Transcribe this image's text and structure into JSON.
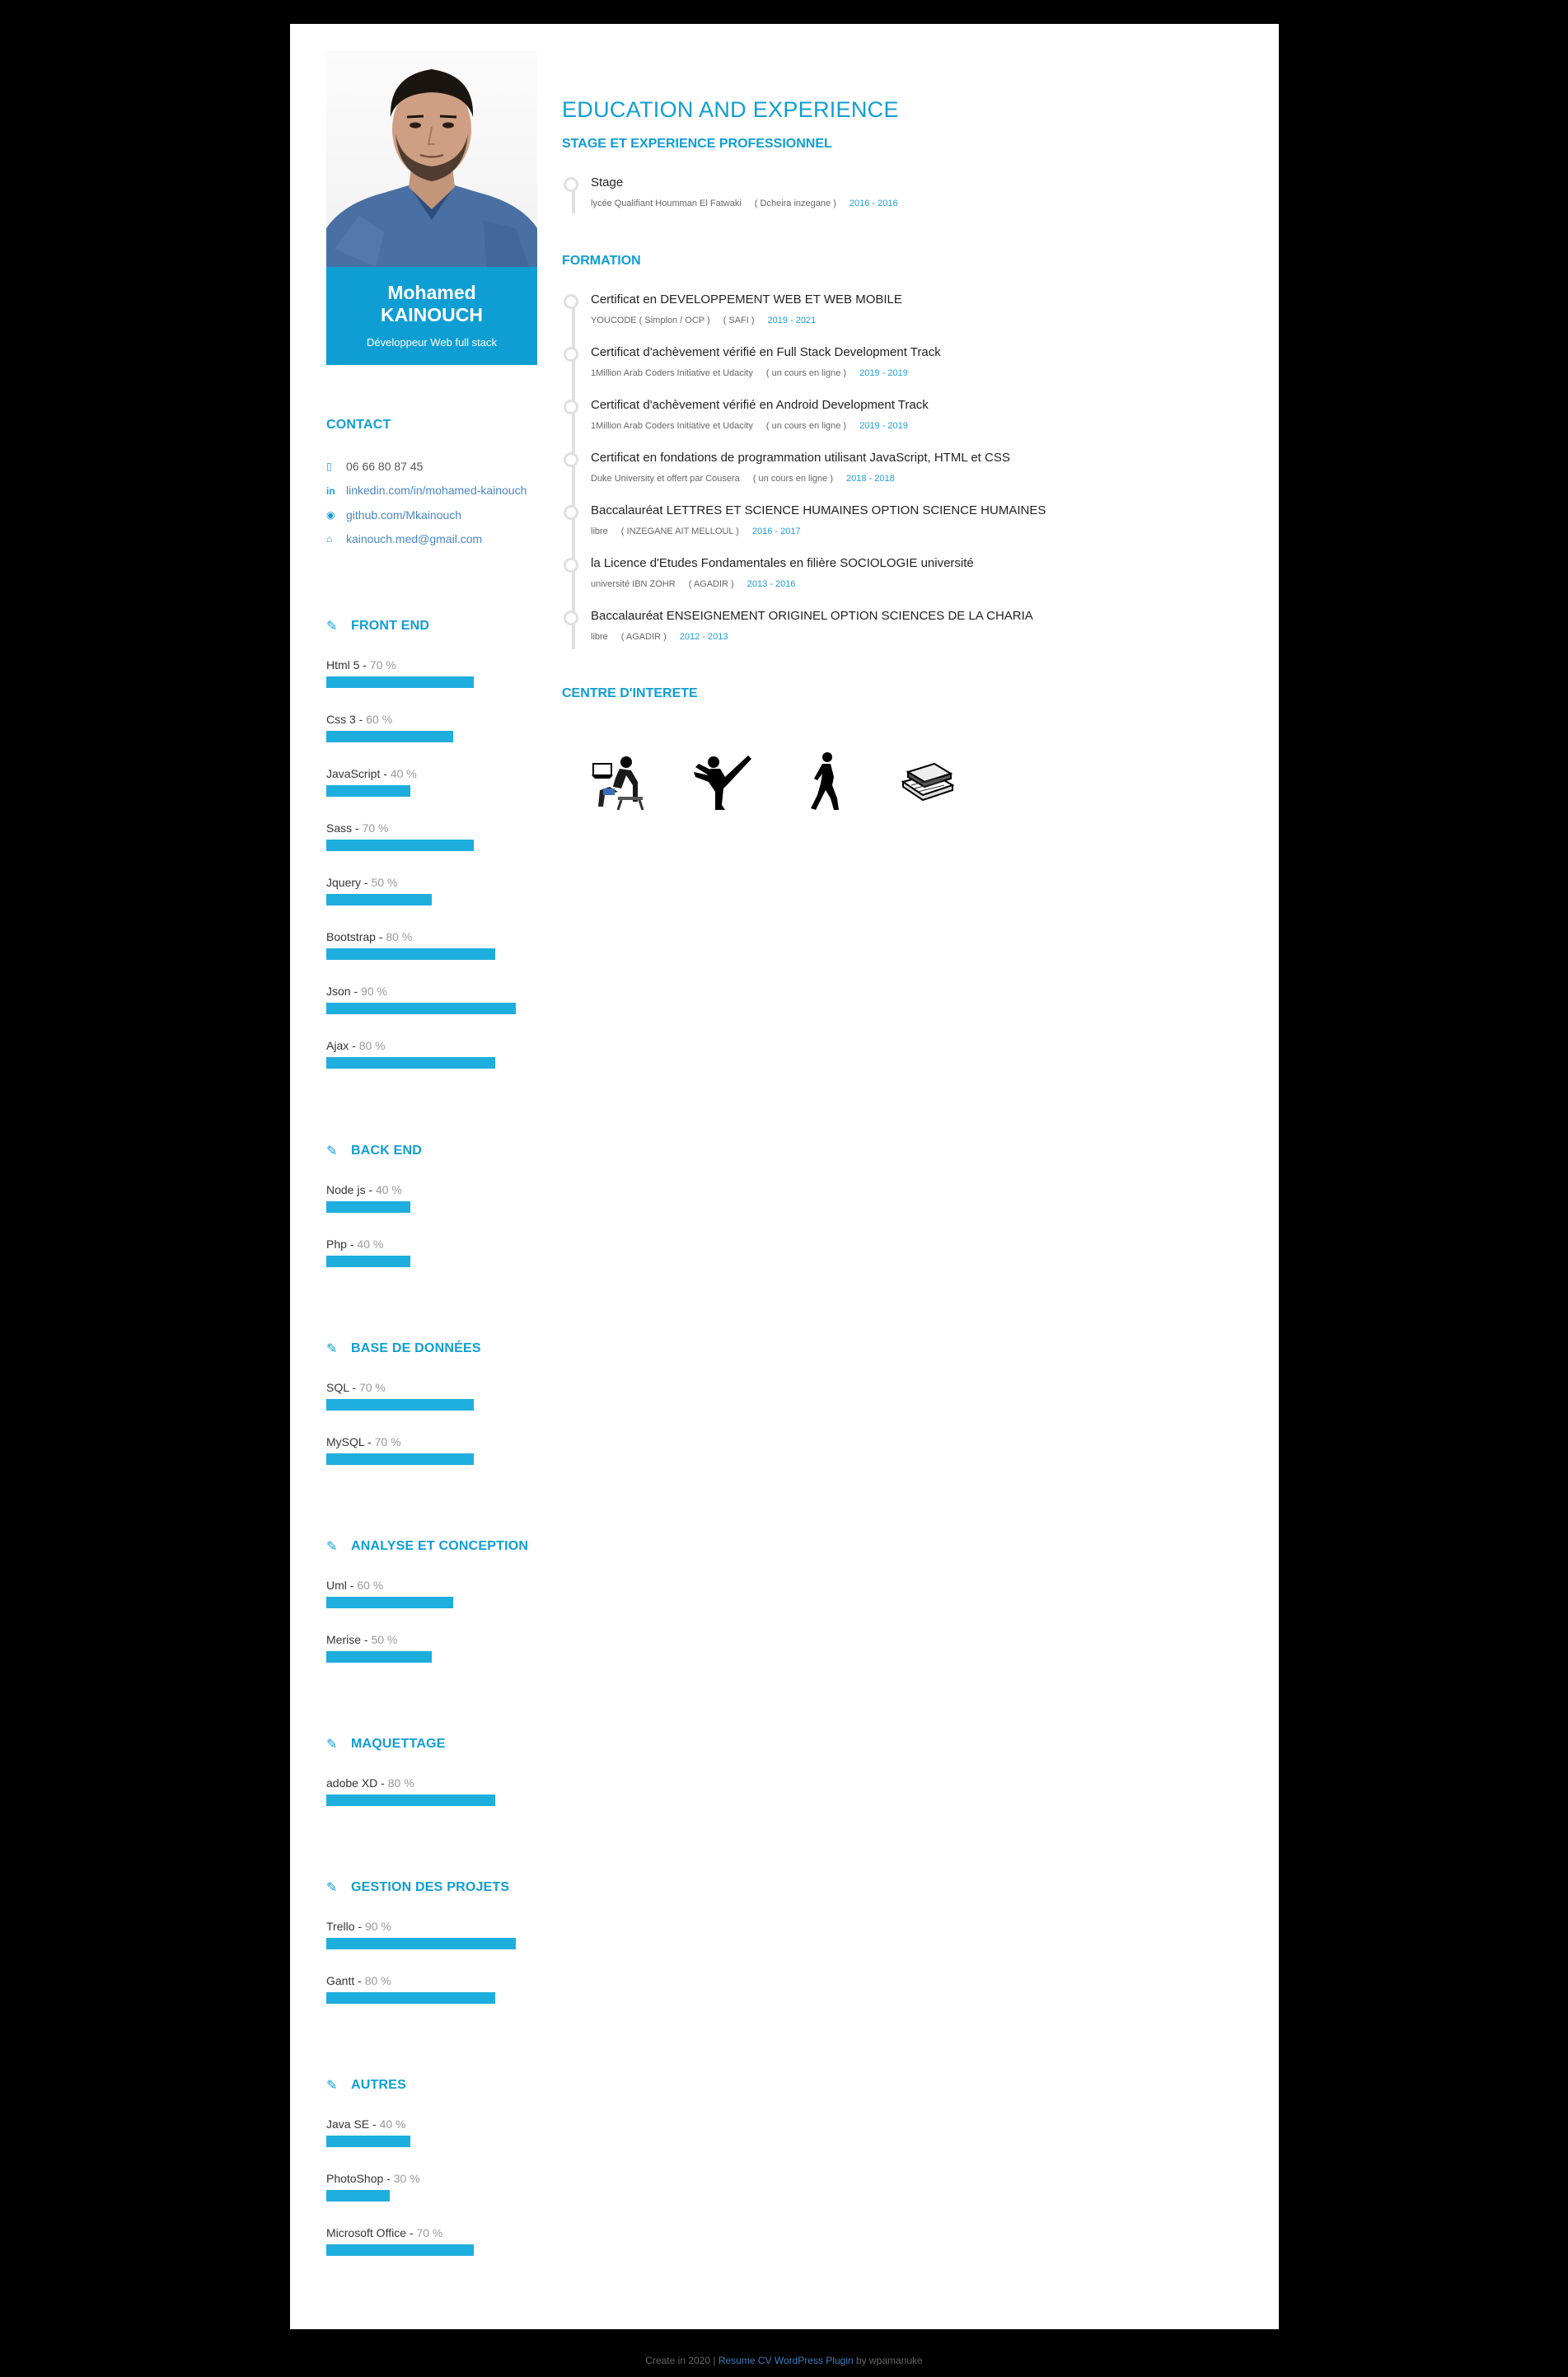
{
  "profile": {
    "first_name": "Mohamed",
    "last_name": "KAINOUCH",
    "job_title": "Développeur Web full stack"
  },
  "contact": {
    "heading": "CONTACT",
    "phone": "06 66 80 87 45",
    "linkedin": "linkedin.com/in/mohamed-kainouch",
    "github": "github.com/Mkainouch",
    "email": "kainouch.med@gmail.com"
  },
  "skill_groups": [
    {
      "title": "FRONT END",
      "skills": [
        {
          "name": "Html 5",
          "percent": 70
        },
        {
          "name": "Css 3",
          "percent": 60
        },
        {
          "name": "JavaScript",
          "percent": 40
        },
        {
          "name": "Sass",
          "percent": 70
        },
        {
          "name": "Jquery",
          "percent": 50
        },
        {
          "name": "Bootstrap",
          "percent": 80
        },
        {
          "name": "Json",
          "percent": 90
        },
        {
          "name": "Ajax",
          "percent": 80
        }
      ]
    },
    {
      "title": "BACK END",
      "skills": [
        {
          "name": "Node js",
          "percent": 40
        },
        {
          "name": "Php",
          "percent": 40
        }
      ]
    },
    {
      "title": "BASE DE DONNÉES",
      "skills": [
        {
          "name": "SQL",
          "percent": 70
        },
        {
          "name": "MySQL",
          "percent": 70
        }
      ]
    },
    {
      "title": "ANALYSE ET CONCEPTION",
      "skills": [
        {
          "name": "Uml",
          "percent": 60
        },
        {
          "name": "Merise",
          "percent": 50
        }
      ]
    },
    {
      "title": "MAQUETTAGE",
      "skills": [
        {
          "name": "adobe XD",
          "percent": 80
        }
      ]
    },
    {
      "title": "GESTION DES PROJETS",
      "skills": [
        {
          "name": "Trello",
          "percent": 90
        },
        {
          "name": "Gantt",
          "percent": 80
        }
      ]
    },
    {
      "title": "AUTRES",
      "skills": [
        {
          "name": "Java SE",
          "percent": 40
        },
        {
          "name": "PhotoShop",
          "percent": 30
        },
        {
          "name": "Microsoft Office",
          "percent": 70
        }
      ]
    }
  ],
  "main": {
    "title": "EDUCATION AND EXPERIENCE",
    "experience_title": "STAGE ET EXPERIENCE PROFESSIONNEL",
    "experience": [
      {
        "title": "Stage",
        "place": "lycée Qualifiant Houmman El Fatwaki",
        "location": "( Dcheira inzegane )",
        "dates": "2016 - 2016"
      }
    ],
    "formation_title": "FORMATION",
    "formation": [
      {
        "title": "Certificat en DEVELOPPEMENT WEB ET WEB MOBILE",
        "place": "YOUCODE ( Simplon / OCP )",
        "location": "( SAFI )",
        "dates": "2019 - 2021"
      },
      {
        "title": "Certificat d'achèvement vérifié en Full Stack Development Track",
        "place": "1Million Arab Coders Initiative et Udacity",
        "location": "( un cours en ligne )",
        "dates": "2019 - 2019"
      },
      {
        "title": "Certificat d'achèvement vérifié en Android Development Track",
        "place": "1Million Arab Coders Initiative et Udacity",
        "location": "( un cours en ligne )",
        "dates": "2019 - 2019"
      },
      {
        "title": "Certificat en fondations de programmation utilisant JavaScript, HTML et CSS",
        "place": "Duke University et offert par Cousera",
        "location": "( un cours en ligne )",
        "dates": "2018 - 2018"
      },
      {
        "title": "Baccalauréat LETTRES ET SCIENCE HUMAINES OPTION SCIENCE HUMAINES",
        "place": "libre",
        "location": "( INZEGANE AIT MELLOUL )",
        "dates": "2016 - 2017"
      },
      {
        "title": "la Licence d'Etudes Fondamentales en filière SOCIOLOGIE université",
        "place": "université IBN ZOHR",
        "location": "( AGADIR )",
        "dates": "2013 - 2016"
      },
      {
        "title": "Baccalauréat ENSEIGNEMENT ORIGINEL OPTION SCIENCES DE LA CHARIA",
        "place": "libre",
        "location": "( AGADIR )",
        "dates": "2012 - 2013"
      }
    ],
    "interests_title": "CENTRE D'INTERETE",
    "interests": [
      "computer-user-icon",
      "karate-kick-icon",
      "runner-icon",
      "books-icon"
    ]
  },
  "footer": {
    "prefix": "Create in 2020 | ",
    "link": "Resume CV WordPress Plugin",
    "suffix": " by wpamanuke"
  },
  "colors": {
    "accent": "#0f9ed3",
    "bar": "#1eaede",
    "background": "#000000"
  }
}
